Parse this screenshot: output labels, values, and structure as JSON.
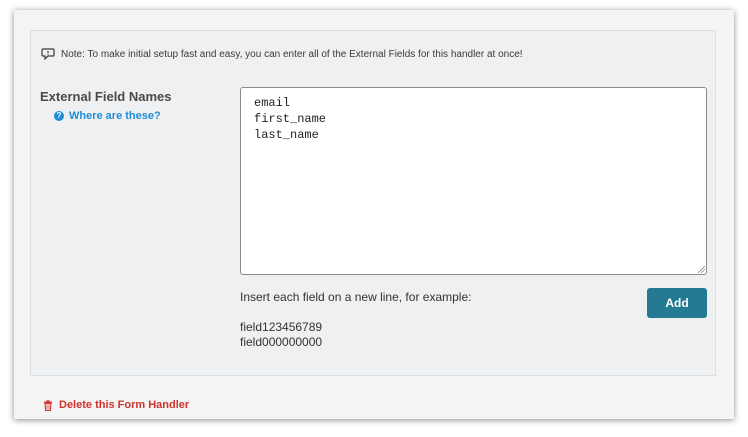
{
  "note": {
    "icon": "speech-bubble-icon",
    "text": "Note: To make initial setup fast and easy, you can enter all of the External Fields for this handler at once!"
  },
  "field": {
    "label": "External Field Names",
    "help_link": "Where are these?",
    "help_icon": "question-circle-icon",
    "textarea_value": "email\nfirst_name\nlast_name",
    "hint": "Insert each field on a new line, for example:",
    "examples": [
      "field123456789",
      "field000000000"
    ]
  },
  "actions": {
    "add_label": "Add",
    "delete_label": "Delete this Form Handler",
    "delete_icon": "trash-icon"
  },
  "colors": {
    "accent": "#237a92",
    "link": "#1f8dd6",
    "danger": "#d0322c"
  }
}
